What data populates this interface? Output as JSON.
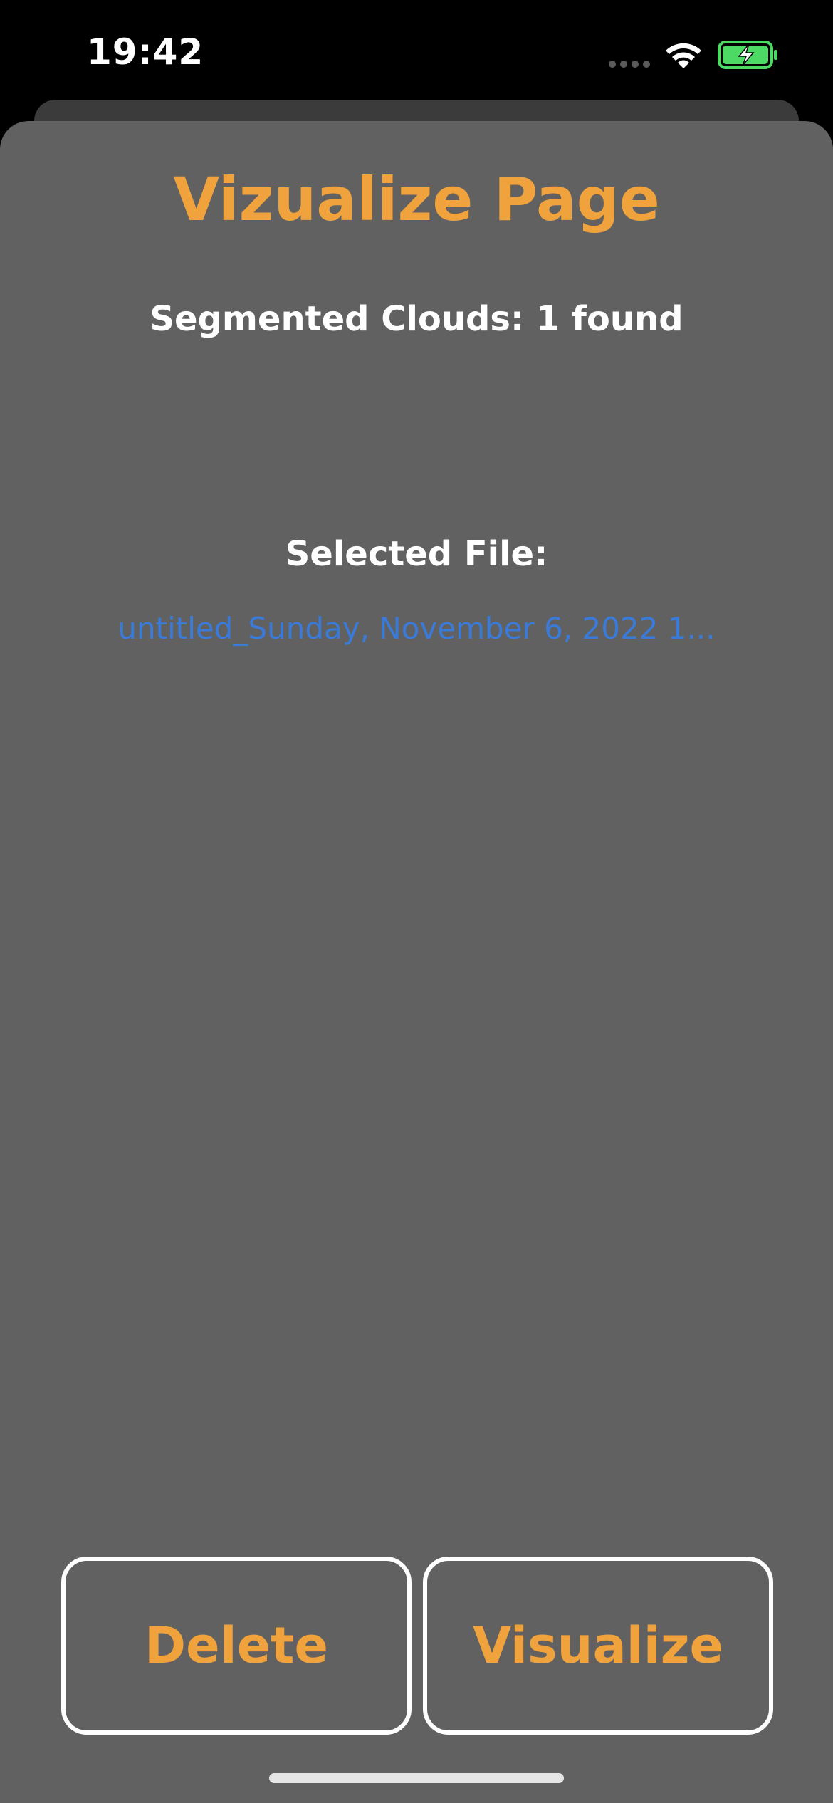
{
  "status_bar": {
    "time": "19:42",
    "icons": [
      "signal-dots-icon",
      "wifi-icon",
      "battery-charging-icon"
    ]
  },
  "page": {
    "title": "Vizualize Page",
    "clouds_count": "Segmented Clouds: 1 found",
    "selected_file_label": "Selected File:",
    "selected_file_value": "untitled_Sunday, November 6, 2022 1..."
  },
  "buttons": {
    "delete_label": "Delete",
    "visualize_label": "Visualize"
  },
  "colors": {
    "accent": "#f0a23d",
    "link": "#3a7bd9",
    "sheet_background": "#616161",
    "battery_fill": "#4cd964"
  }
}
